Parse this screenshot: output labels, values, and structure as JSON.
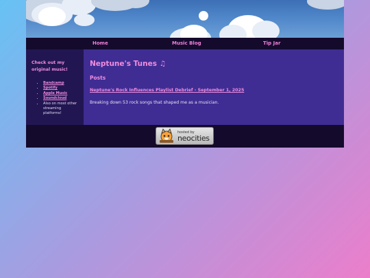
{
  "nav": {
    "home": "Home",
    "music_blog": "Music Blog",
    "tip_jar": "Tip Jar"
  },
  "sidebar": {
    "title": "Check out my original music!",
    "items": [
      {
        "label": "Bandcamp"
      },
      {
        "label": "Spotify"
      },
      {
        "label": "Apple Music"
      },
      {
        "label": "Soundcloud"
      },
      {
        "label": "Also on most other streaming platforms!"
      }
    ]
  },
  "main": {
    "title": "Neptune's Tunes",
    "title_icon": "♫",
    "section_heading": "Posts",
    "post": {
      "title": "Neptune's Rock Influences Playlist Debrief - September 1, 2025",
      "description": "Breaking down 53 rock songs that shaped me as a musician."
    }
  },
  "footer": {
    "badge_hosted": "hosted by",
    "badge_brand": "neocities"
  },
  "colors": {
    "accent": "#f08ddf",
    "nav_bg": "#140a2c",
    "sidebar_bg": "#221652",
    "main_bg": "#3f2d93"
  }
}
